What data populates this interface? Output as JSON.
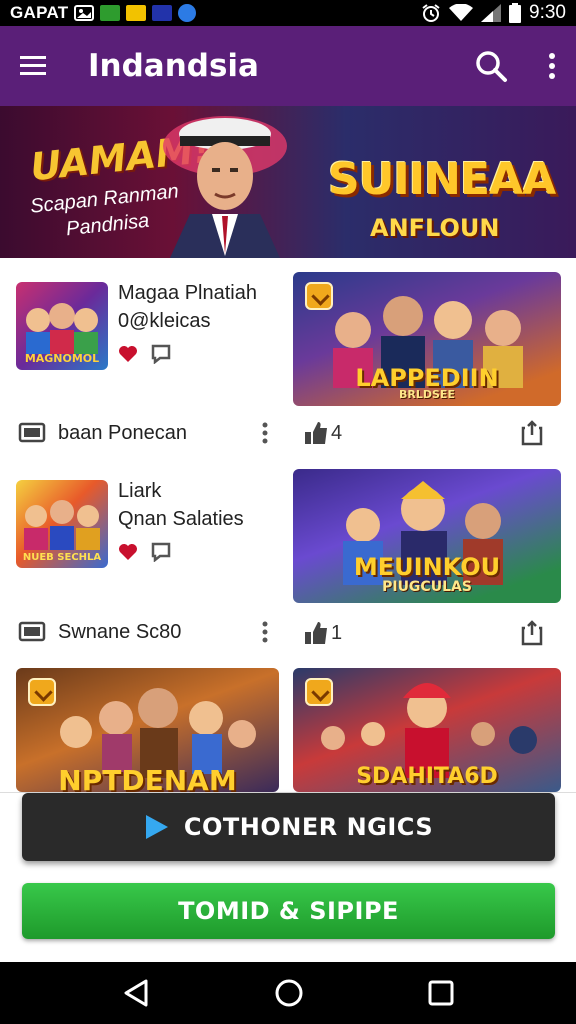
{
  "status_bar": {
    "carrier": "GAPAT",
    "time": "9:30",
    "icons": [
      "photo-icon",
      "app-icon-green",
      "app-icon-yellow",
      "app-icon-blue",
      "app-icon-circle",
      "alarm-icon",
      "wifi-icon",
      "signal-icon",
      "battery-icon"
    ]
  },
  "app_bar": {
    "title": "Indandsia",
    "icons": [
      "menu-icon",
      "search-icon",
      "more-vert-icon"
    ]
  },
  "banner": {
    "headline": "UAMAM!",
    "subline1": "Scapan Ranman",
    "subline2": "Pandnisa",
    "logo_main": "SUIINEAA",
    "logo_sub": "ANFLOUN"
  },
  "feed": {
    "list_cards": [
      {
        "thumb_text": "MAGNOMOL",
        "title": "Magaa Plnatiah",
        "subtitle": "0@kleicas",
        "footer_label": "baan Ponecan"
      },
      {
        "thumb_text": "NUEB SECHLA",
        "title": "Liark",
        "subtitle": "Qnan Salaties",
        "footer_label": "Swnane Sc80"
      }
    ],
    "grid_cards": [
      {
        "art_title": "LAPPEDIIN",
        "art_sub": "BRLDSEE",
        "count": "4"
      },
      {
        "art_title": "MEUINKOU",
        "art_sub": "PIUGCULAS",
        "count": "1"
      },
      {
        "art_title": "NPTDENAM",
        "art_sub": ""
      },
      {
        "art_title": "SDAHITA6D",
        "art_sub": ""
      }
    ]
  },
  "bottom": {
    "promo_label": "COTHONER NGICS",
    "cta_label": "TOMID & SIPIPE"
  },
  "colors": {
    "app_bar": "#5a1f78",
    "heart": "#c8102e",
    "cta_green": "#2db53c",
    "promo_dark": "#2a2a2a"
  }
}
